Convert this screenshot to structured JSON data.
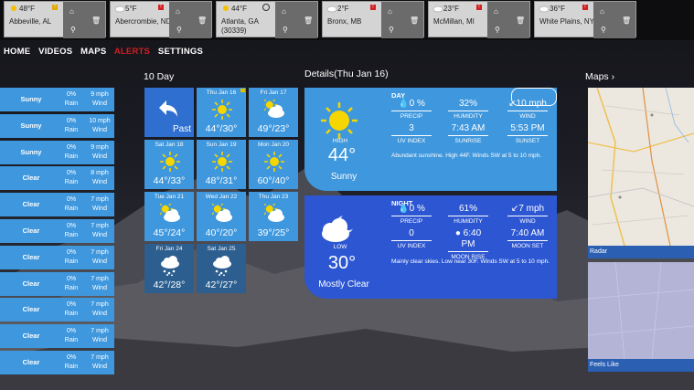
{
  "cities": [
    {
      "name": "Abbeville, AL",
      "temp": "48°F",
      "icon": "sun-icon",
      "alert": "yellow"
    },
    {
      "name": "Abercrombie, ND",
      "temp": "5°F",
      "icon": "cloud-icon",
      "alert": "red"
    },
    {
      "name": "Atlanta, GA\n(30339)",
      "temp": "44°F",
      "icon": "sun-icon",
      "alert": "none",
      "current": true
    },
    {
      "name": "Bronx, MB",
      "temp": "2°F",
      "icon": "cloud-icon",
      "alert": "red"
    },
    {
      "name": "McMillan, MI",
      "temp": "23°F",
      "icon": "cloud-icon",
      "alert": "red"
    },
    {
      "name": "White Plains, NY",
      "temp": "36°F",
      "icon": "cloud-icon",
      "alert": "red"
    }
  ],
  "nav": {
    "home": "HOME",
    "videos": "VIDEOS",
    "maps": "MAPS",
    "alerts": "ALERTS",
    "settings": "SETTINGS"
  },
  "headings": {
    "ten_day": "10 Day",
    "details": "Details(Thu Jan 16)",
    "maps": "Maps"
  },
  "hourly": [
    {
      "cond": "Sunny",
      "rain": "0%",
      "rain_label": "Rain",
      "wind": "9 mph",
      "wind_label": "Wind"
    },
    {
      "cond": "Sunny",
      "rain": "0%",
      "rain_label": "Rain",
      "wind": "10 mph",
      "wind_label": "Wind"
    },
    {
      "cond": "Sunny",
      "rain": "0%",
      "rain_label": "Rain",
      "wind": "9 mph",
      "wind_label": "Wind"
    },
    {
      "cond": "Clear",
      "rain": "0%",
      "rain_label": "Rain",
      "wind": "8 mph",
      "wind_label": "Wind"
    },
    {
      "cond": "Clear",
      "rain": "0%",
      "rain_label": "Rain",
      "wind": "7 mph",
      "wind_label": "Wind"
    },
    {
      "cond": "Clear",
      "rain": "0%",
      "rain_label": "Rain",
      "wind": "7 mph",
      "wind_label": "Wind"
    },
    {
      "cond": "Clear",
      "rain": "0%",
      "rain_label": "Rain",
      "wind": "7 mph",
      "wind_label": "Wind"
    },
    {
      "cond": "Clear",
      "rain": "0%",
      "rain_label": "Rain",
      "wind": "7 mph",
      "wind_label": "Wind"
    },
    {
      "cond": "Clear",
      "rain": "0%",
      "rain_label": "Rain",
      "wind": "7 mph",
      "wind_label": "Wind"
    },
    {
      "cond": "Clear",
      "rain": "0%",
      "rain_label": "Rain",
      "wind": "7 mph",
      "wind_label": "Wind"
    },
    {
      "cond": "Clear",
      "rain": "0%",
      "rain_label": "Rain",
      "wind": "7 mph",
      "wind_label": "Wind"
    }
  ],
  "past_label": "Past",
  "days": [
    {
      "date": "Thu Jan 16",
      "temps": "44°/30°",
      "icon": "sun-icon",
      "flag": true
    },
    {
      "date": "Fri Jan 17",
      "temps": "49°/23°",
      "icon": "partly-cloudy-icon"
    },
    {
      "date": "Sat Jan 18",
      "temps": "44°/33°",
      "icon": "sun-icon"
    },
    {
      "date": "Sun Jan 19",
      "temps": "48°/31°",
      "icon": "sun-icon"
    },
    {
      "date": "Mon Jan 20",
      "temps": "60°/40°",
      "icon": "sun-icon"
    },
    {
      "date": "Tue Jan 21",
      "temps": "45°/24°",
      "icon": "partly-cloudy-icon"
    },
    {
      "date": "Wed Jan 22",
      "temps": "40°/20°",
      "icon": "partly-cloudy-icon"
    },
    {
      "date": "Thu Jan 23",
      "temps": "39°/25°",
      "icon": "partly-cloudy-icon"
    },
    {
      "date": "Fri Jan 24",
      "temps": "42°/28°",
      "icon": "rain-icon"
    },
    {
      "date": "Sat Jan 25",
      "temps": "42°/27°",
      "icon": "rain-icon"
    }
  ],
  "day": {
    "label": "DAY",
    "hl": "HIGH",
    "temp": "44°",
    "cond": "Sunny",
    "precip": "0 %",
    "precip_label": "PRECIP",
    "humidity": "32%",
    "humidity_label": "HUMIDITY",
    "wind": "10 mph",
    "wind_label": "WIND",
    "uv": "3",
    "uv_label": "UV INDEX",
    "rise": "7:43 AM",
    "rise_label": "SUNRISE",
    "set": "5:53 PM",
    "set_label": "SUNSET",
    "summary": "Abundant sunshine. High 44F. Winds SW at 5 to 10 mph."
  },
  "night": {
    "label": "NIGHT",
    "hl": "LOW",
    "temp": "30°",
    "cond": "Mostly Clear",
    "precip": "0 %",
    "precip_label": "PRECIP",
    "humidity": "61%",
    "humidity_label": "HUMIDITY",
    "wind": "7 mph",
    "wind_label": "WIND",
    "uv": "0",
    "uv_label": "UV INDEX",
    "rise": "6:40 PM",
    "rise_label": "MOON RISE",
    "set": "7:40 AM",
    "set_label": "MOON SET",
    "summary": "Mainly clear skies. Low near 30F. Winds SW at 5 to 10 mph."
  },
  "maps": [
    {
      "caption": "Radar"
    },
    {
      "caption": "Feels Like"
    }
  ],
  "colors": {
    "tile": "#3f97dd",
    "night": "#2d57d2",
    "alert": "#d02020"
  }
}
